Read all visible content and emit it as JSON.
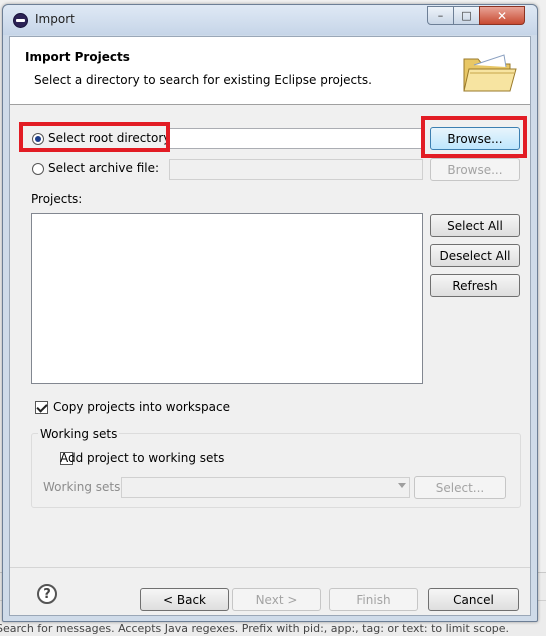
{
  "background": {
    "hint_text": "Search for messages. Accepts Java regexes. Prefix with pid:, app:, tag: or text: to limit scope."
  },
  "window": {
    "title": "Import",
    "minimize_glyph": "–",
    "maximize_glyph": "□",
    "close_glyph": "✕"
  },
  "header": {
    "title": "Import Projects",
    "description": "Select a directory to search for existing Eclipse projects."
  },
  "source": {
    "root_directory_label": "Select root directory:",
    "root_directory_value": "",
    "root_browse_label": "Browse...",
    "archive_file_label": "Select archive file:",
    "archive_file_value": "",
    "archive_browse_label": "Browse..."
  },
  "projects": {
    "label": "Projects:",
    "items": [],
    "select_all_label": "Select All",
    "deselect_all_label": "Deselect All",
    "refresh_label": "Refresh"
  },
  "options": {
    "copy_into_workspace_label": "Copy projects into workspace",
    "copy_into_workspace_checked": true
  },
  "working_sets": {
    "group_label": "Working sets",
    "add_label": "Add project to working sets",
    "add_checked": false,
    "field_label": "Working sets:",
    "field_value": "",
    "select_label": "Select..."
  },
  "footer": {
    "help_glyph": "?",
    "back_label": "< Back",
    "next_label": "Next >",
    "finish_label": "Finish",
    "cancel_label": "Cancel"
  },
  "colors": {
    "highlight_border": "#e21c24",
    "radio_selected": "#1b3d8a",
    "focus_button": "#bee6fd"
  }
}
